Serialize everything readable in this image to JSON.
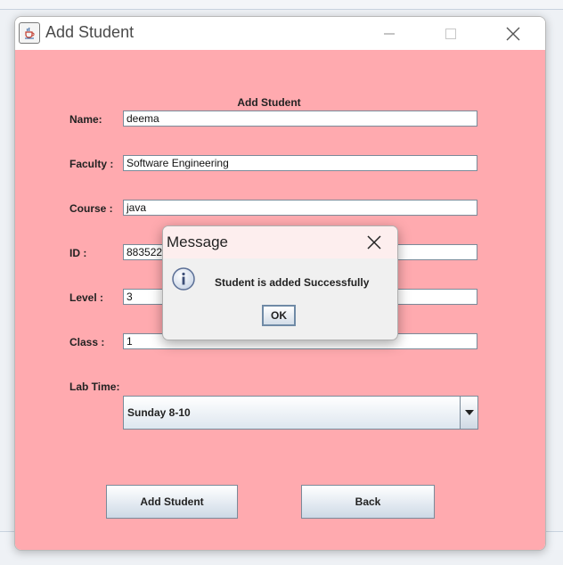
{
  "window": {
    "title": "Add Student",
    "icons": {
      "app": "java-cup-icon",
      "minimize": "minimize-icon",
      "maximize": "maximize-icon",
      "close": "close-icon"
    }
  },
  "form": {
    "heading": "Add Student",
    "fields": [
      {
        "label": "Name:",
        "value": "deema"
      },
      {
        "label": "Faculty :",
        "value": "Software Engineering"
      },
      {
        "label": "Course :",
        "value": "java"
      },
      {
        "label": "ID :",
        "value": "883522"
      },
      {
        "label": "Level :",
        "value": "3"
      },
      {
        "label": "Class :",
        "value": "1"
      }
    ],
    "lab_time": {
      "label": "Lab Time:",
      "selected": "Sunday 8-10"
    },
    "buttons": {
      "add": "Add Student",
      "back": "Back"
    },
    "background_color": "#ffaaaf"
  },
  "dialog": {
    "title": "Message",
    "message": "Student is added Successfully",
    "ok": "OK",
    "icon": "info-icon"
  }
}
